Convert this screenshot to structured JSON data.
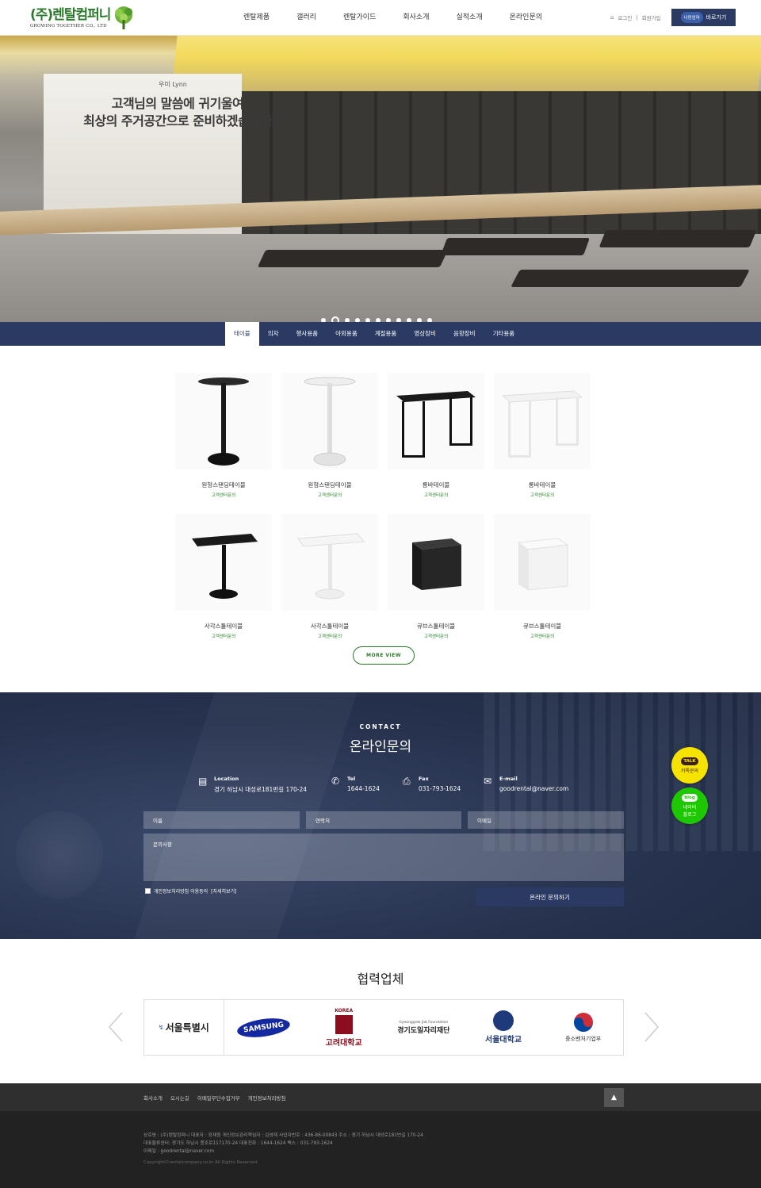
{
  "header": {
    "logo_title": "(주)렌탈컴퍼니",
    "logo_sub": "GROWING TOGETHER CO., LTD",
    "nav": [
      "렌탈제품",
      "갤러리",
      "렌탈가이드",
      "회사소개",
      "실적소개",
      "온라인문의"
    ],
    "login": "로그인",
    "divider": "|",
    "join": "회원가입",
    "shortcut_logo": "너랑엄마",
    "shortcut_label": "바로가기"
  },
  "hero": {
    "brand": "우미 Lynn",
    "line1": "고객님의 말씀에 귀기울여",
    "line2": "최상의 주거공간으로 준비하겠습니다",
    "slide_count": 11,
    "active_slide": 2
  },
  "categories": [
    "테이블",
    "의자",
    "행사용품",
    "야외용품",
    "계절용품",
    "영상장비",
    "음향장비",
    "기타용품"
  ],
  "products": [
    {
      "name": "원형스탠딩테이블",
      "sub": "고객센터문의",
      "kind": "round-black"
    },
    {
      "name": "원형스탠딩테이블",
      "sub": "고객센터문의",
      "kind": "round-white"
    },
    {
      "name": "롱바테이블",
      "sub": "고객센터문의",
      "kind": "bar-black"
    },
    {
      "name": "롱바테이블",
      "sub": "고객센터문의",
      "kind": "bar-white"
    },
    {
      "name": "사각스툴테이블",
      "sub": "고객센터문의",
      "kind": "square-black"
    },
    {
      "name": "사각스툴테이블",
      "sub": "고객센터문의",
      "kind": "square-white"
    },
    {
      "name": "큐브스툴테이블",
      "sub": "고객센터문의",
      "kind": "cube-black"
    },
    {
      "name": "큐브스툴테이블",
      "sub": "고객센터문의",
      "kind": "cube-white"
    }
  ],
  "more_label": "MORE VIEW",
  "contact": {
    "kicker": "CONTACT",
    "title": "온라인문의",
    "location_label": "Location",
    "location_value": "경기 하남시 대성로181번길 170-24",
    "tel_label": "Tel",
    "tel_value": "1644-1624",
    "fax_label": "Fax",
    "fax_value": "031-793-1624",
    "email_label": "E-mail",
    "email_value": "goodrental@naver.com",
    "name_ph": "이름",
    "phone_ph": "연락처",
    "email_ph": "이메일",
    "message_ph": "문의사항",
    "agree_text": "개인정보처리방침 이용동의",
    "agree_link": "[자세히보기]",
    "submit": "온라인 문의하기"
  },
  "floating": {
    "kakao_badge": "TALK",
    "kakao_label": "카톡문의",
    "blog_badge": "blog",
    "blog_label1": "네이버",
    "blog_label2": "블로그"
  },
  "partners": {
    "title": "협력업체",
    "items": [
      "서울특별시",
      "SAMSUNG",
      "고려대학교",
      "경기도일자리재단",
      "서울대학교",
      "중소벤처기업부"
    ],
    "korea_text": "KOREA",
    "gyeonggi_sub": "Gyeonggido Job Foundation"
  },
  "footer": {
    "links": [
      "회사소개",
      "오시는길",
      "이메일무단수집거부",
      "개인정보처리방침"
    ],
    "top_label": "▲",
    "line1": "상호명 : (주)렌탈컴퍼니    대표자 : 장재원    개인정보관리책임자 : 김영제    사업자번호 : 436-86-00843    주소 : 경기 하남시 대성로181번길 170-24",
    "line2": "대표물류센터: 경기도 하남시 풍조로117170-24    대표전화 : 1644-1624    팩스 : 031-793-1624",
    "line3": "이메일 : goodrental@naver.com",
    "copyright": "Copyright©rentalcompany.co.kr All Rights Reserved"
  },
  "colors": {
    "navy": "#2a3a63",
    "green": "#2b7a2b",
    "kakao": "#f7e300",
    "naver": "#1ec800"
  }
}
